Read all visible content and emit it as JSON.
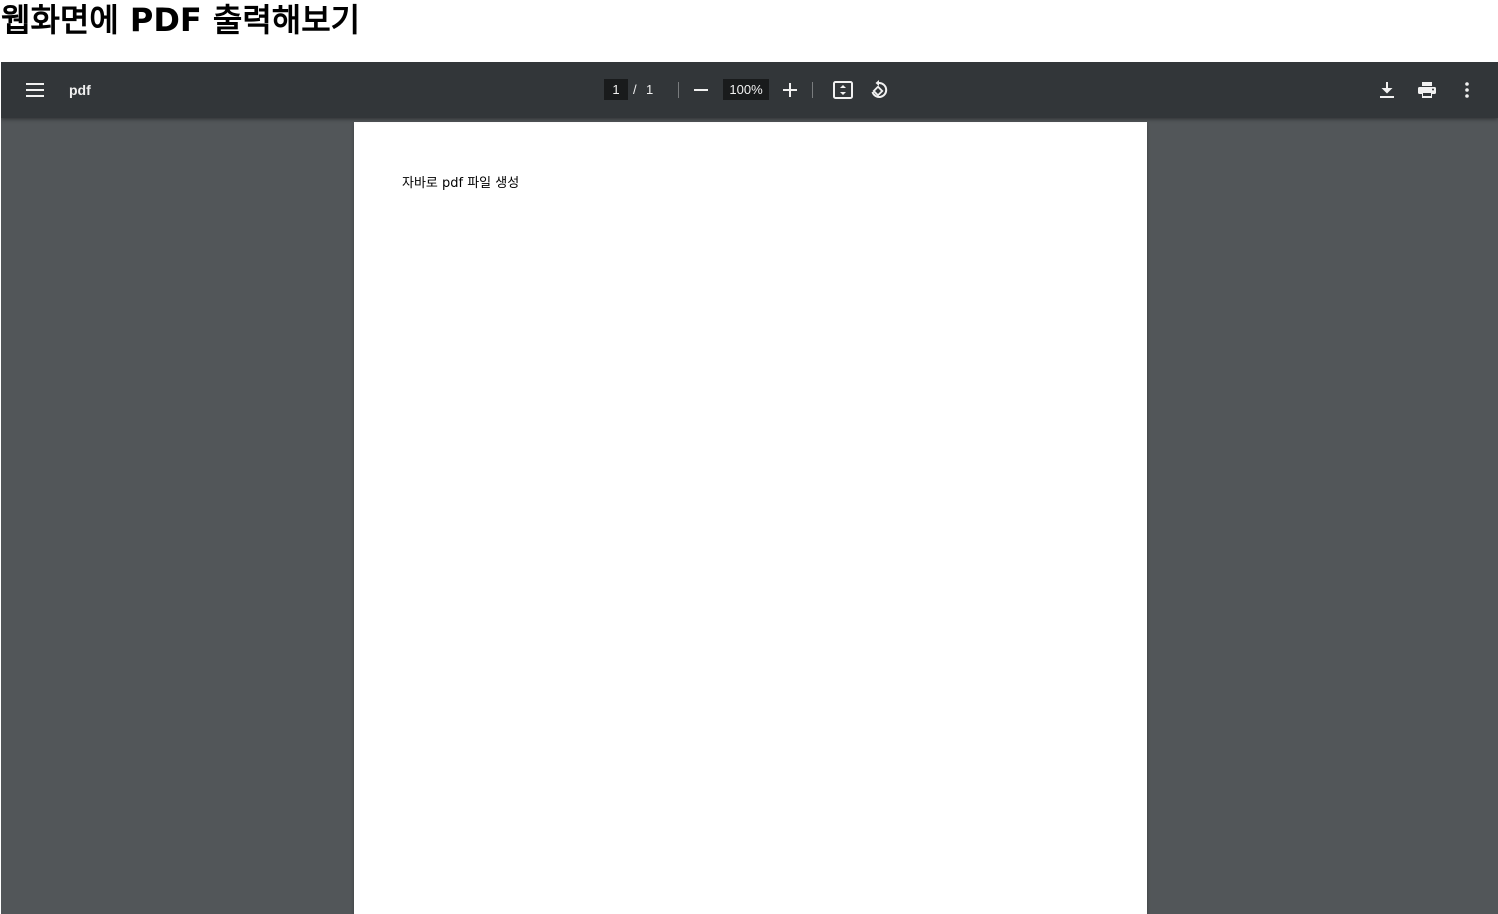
{
  "page": {
    "heading": "웹화면에 PDF 출력해보기"
  },
  "viewer": {
    "toolbar": {
      "menu_icon": "hamburger-menu-icon",
      "title": "pdf",
      "current_page": "1",
      "page_separator": "/",
      "total_pages": "1",
      "zoom_out_icon": "minus-icon",
      "zoom_level": "100%",
      "zoom_in_icon": "plus-icon",
      "fit_icon": "fit-to-page-icon",
      "rotate_icon": "rotate-icon",
      "download_icon": "download-icon",
      "print_icon": "print-icon",
      "more_icon": "more-vertical-icon"
    },
    "document": {
      "text": "자바로 pdf 파일 생성"
    },
    "colors": {
      "toolbar_bg": "#323639",
      "viewer_bg": "#525659",
      "page_bg": "#ffffff",
      "toolbar_text": "#f1f1f1"
    }
  }
}
